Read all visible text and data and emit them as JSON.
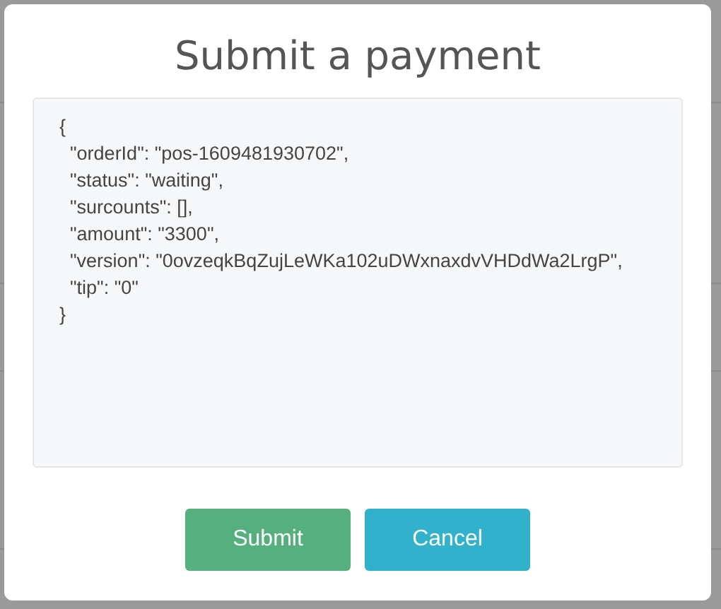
{
  "dialog": {
    "title": "Submit a payment",
    "payload": {
      "value": "{\n  \"orderId\": \"pos-1609481930702\",\n  \"status\": \"waiting\",\n  \"surcounts\": [],\n  \"amount\": \"3300\",\n  \"version\": \"0ovzeqkBqZujLeWKa102uDWxnaxdvVHDdWa2LrgP\",\n  \"tip\": \"0\"\n}"
    },
    "buttons": [
      {
        "label": "Submit",
        "kind": "primary"
      },
      {
        "label": "Cancel",
        "kind": "secondary"
      }
    ]
  }
}
